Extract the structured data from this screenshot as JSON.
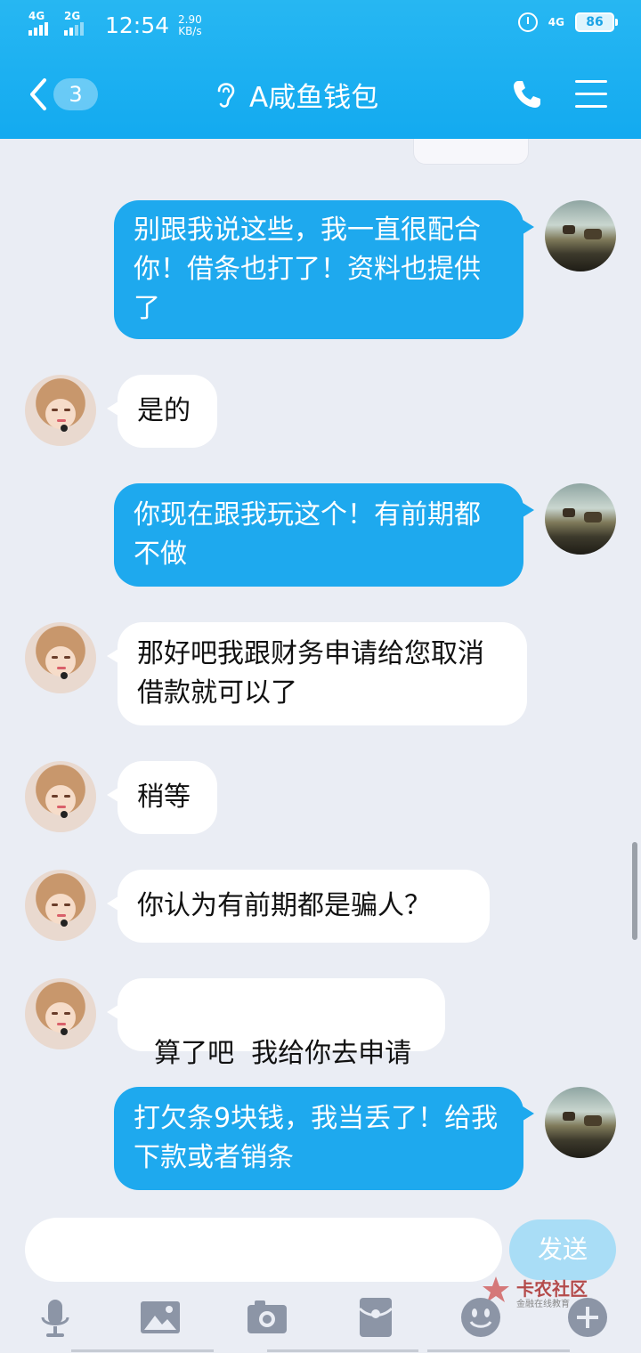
{
  "status_bar": {
    "net1": "4G",
    "net2": "2G",
    "time": "12:54",
    "speed_value": "2.90",
    "speed_unit": "KB/s",
    "net3": "4G",
    "battery": "86"
  },
  "header": {
    "unread_count": "3",
    "title": "A咸鱼钱包"
  },
  "messages": [
    {
      "from": "me",
      "text": "别跟我说这些，我一直很配合你！借条也打了！资料也提供了"
    },
    {
      "from": "them",
      "text": "是的"
    },
    {
      "from": "me",
      "text": "你现在跟我玩这个！有前期都不做"
    },
    {
      "from": "them",
      "text": "那好吧我跟财务申请给您取消借款就可以了"
    },
    {
      "from": "them",
      "text": "稍等"
    },
    {
      "from": "them",
      "text": "你认为有前期都是骗人？"
    },
    {
      "from": "them",
      "text": "算了吧  我给你去申请"
    },
    {
      "from": "me",
      "text": "打欠条9块钱，我当丢了！给我下款或者销条"
    }
  ],
  "composer": {
    "input_value": "",
    "send_label": "发送"
  },
  "toolbar_icons": [
    "microphone-icon",
    "image-icon",
    "camera-icon",
    "red-packet-icon",
    "emoji-icon",
    "plus-icon"
  ],
  "watermark": {
    "main": "卡农社区",
    "sub": "金融在线教育"
  },
  "colors": {
    "header": "#13aaf0",
    "outgoing_bubble": "#1ea9ee",
    "incoming_bubble": "#ffffff",
    "background": "#eaedf4",
    "send_button_disabled": "#a9ddf6"
  }
}
